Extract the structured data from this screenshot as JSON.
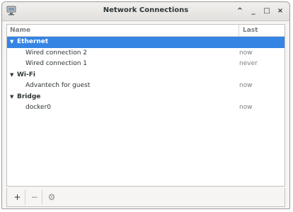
{
  "window": {
    "title": "Network Connections",
    "controls": {
      "up": "^",
      "minimize": "_",
      "maximize": "□",
      "close": "×"
    }
  },
  "columns": {
    "name": "Name",
    "last_used": "Last Used",
    "sort_arrow": "▼"
  },
  "groups": [
    {
      "name": "Ethernet",
      "expanded": true,
      "selected": true,
      "arrow": "▼",
      "items": [
        {
          "name": "Wired connection 2",
          "last_used": "now"
        },
        {
          "name": "Wired connection 1",
          "last_used": "never"
        }
      ]
    },
    {
      "name": "Wi-Fi",
      "expanded": true,
      "selected": false,
      "arrow": "▼",
      "items": [
        {
          "name": "Advantech for guest",
          "last_used": "now"
        }
      ]
    },
    {
      "name": "Bridge",
      "expanded": true,
      "selected": false,
      "arrow": "▼",
      "items": [
        {
          "name": "docker0",
          "last_used": "now"
        }
      ]
    }
  ],
  "toolbar": {
    "add": "+",
    "remove": "−",
    "settings": "⚙"
  },
  "colors": {
    "selection": "#3584e4",
    "window_bg": "#f6f5f4"
  },
  "icons": {
    "app": "network-connections-icon"
  }
}
